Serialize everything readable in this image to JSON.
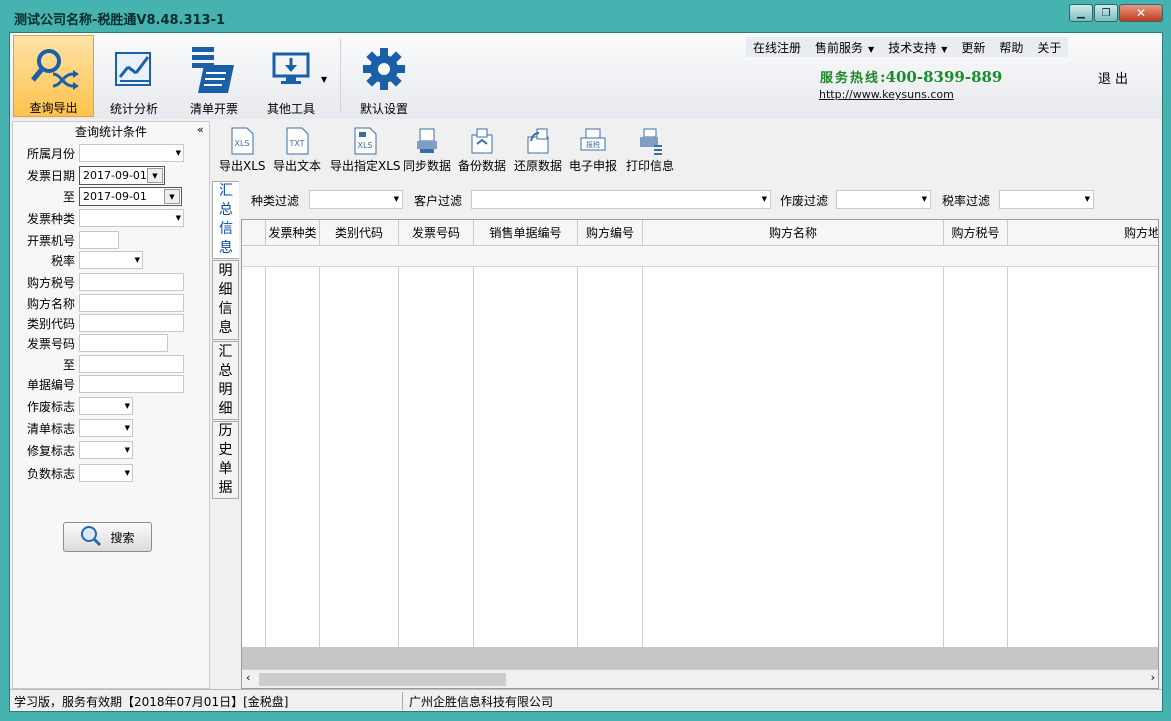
{
  "window": {
    "title": "测试公司名称-税胜通V8.48.313-1",
    "controls": {
      "minimize": "▁",
      "maximize": "❐",
      "close": "✕"
    }
  },
  "ribbon": {
    "buttons": [
      {
        "label": "查询导出",
        "icon": "search-shuffle-icon",
        "active": true
      },
      {
        "label": "统计分析",
        "icon": "chart-icon"
      },
      {
        "label": "清单开票",
        "icon": "list-document-icon"
      },
      {
        "label": "其他工具",
        "icon": "monitor-download-icon",
        "has_dropdown": true
      },
      {
        "label": "默认设置",
        "icon": "gear-icon"
      }
    ],
    "top_menu": [
      {
        "label": "在线注册"
      },
      {
        "label": "售前服务",
        "has_dropdown": true
      },
      {
        "label": "技术支持",
        "has_dropdown": true
      },
      {
        "label": "更新"
      },
      {
        "label": "帮助"
      },
      {
        "label": "关于"
      }
    ],
    "hotline_label": "服务热线",
    "hotline_number": ":400-8399-889",
    "website": "http://www.keysuns.com",
    "exit": "退出"
  },
  "left_panel": {
    "title": "查询统计条件",
    "collapse": "«",
    "fields": [
      {
        "label": "所属月份",
        "type": "select",
        "value": ""
      },
      {
        "label": "发票日期",
        "type": "date",
        "value": "2017-09-01"
      },
      {
        "label": "至",
        "type": "date",
        "value": "2017-09-01"
      },
      {
        "label": "发票种类",
        "type": "select",
        "value": ""
      },
      {
        "label": "开票机号",
        "type": "input",
        "value": ""
      },
      {
        "label": "税率",
        "type": "select",
        "value": ""
      },
      {
        "label": "购方税号",
        "type": "input",
        "value": ""
      },
      {
        "label": "购方名称",
        "type": "input",
        "value": ""
      },
      {
        "label": "类别代码",
        "type": "input",
        "value": ""
      },
      {
        "label": "发票号码",
        "type": "input",
        "value": ""
      },
      {
        "label": "至",
        "type": "input",
        "value": ""
      },
      {
        "label": "单据编号",
        "type": "input",
        "value": ""
      },
      {
        "label": "作废标志",
        "type": "select",
        "value": ""
      },
      {
        "label": "清单标志",
        "type": "select",
        "value": ""
      },
      {
        "label": "修复标志",
        "type": "select",
        "value": ""
      },
      {
        "label": "负数标志",
        "type": "select",
        "value": ""
      }
    ],
    "search_button": "搜索"
  },
  "toolbar": [
    {
      "label": "导出XLS",
      "icon": "export-xls-icon"
    },
    {
      "label": "导出文本",
      "icon": "export-txt-icon"
    },
    {
      "label": "导出指定XLS",
      "icon": "export-selected-xls-icon"
    },
    {
      "label": "同步数据",
      "icon": "sync-data-icon"
    },
    {
      "label": "备份数据",
      "icon": "backup-data-icon"
    },
    {
      "label": "还原数据",
      "icon": "restore-data-icon"
    },
    {
      "label": "电子申报",
      "icon": "e-filing-icon"
    },
    {
      "label": "打印信息",
      "icon": "printer-icon"
    }
  ],
  "icon_texts": {
    "xls": "XLS",
    "txt": "TXT",
    "tax": "报税"
  },
  "vertical_tabs": [
    {
      "label": "汇总信息",
      "active": true
    },
    {
      "label": "明细信息"
    },
    {
      "label": "汇总明细"
    },
    {
      "label": "历史单据"
    }
  ],
  "filters": [
    {
      "label": "种类过滤",
      "value": ""
    },
    {
      "label": "客户过滤",
      "value": ""
    },
    {
      "label": "作废过滤",
      "value": ""
    },
    {
      "label": "税率过滤",
      "value": ""
    }
  ],
  "grid": {
    "columns": [
      "发票种类",
      "类别代码",
      "发票号码",
      "销售单据编号",
      "购方编号",
      "购方名称",
      "购方税号",
      "购方地"
    ],
    "rows": [],
    "scroll_left": "‹",
    "scroll_right": "›"
  },
  "status": {
    "left": "学习版，服务有效期【2018年07月01日】[金税盘]",
    "company": "广州企胜信息科技有限公司"
  }
}
